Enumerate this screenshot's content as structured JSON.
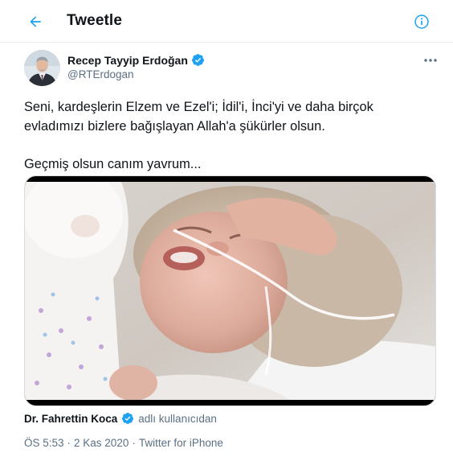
{
  "header": {
    "title": "Tweetle",
    "back_icon": "arrow-left-icon",
    "info_icon": "info-circle-icon",
    "accent_color": "#1da1f2"
  },
  "tweet": {
    "author": {
      "name": "Recep Tayyip Erdoğan",
      "handle": "@RTErdogan",
      "verified": true,
      "verified_color": "#1da1f2"
    },
    "more_icon": "more-dots-icon",
    "text": [
      "Seni, kardeşlerin Elzem ve Ezel'i; İdil'i, İnci'yi ve daha birçok evladımızı bizlere bağışlayan Allah'a şükürler olsun.",
      "Geçmiş olsun canım yavrum..."
    ],
    "attribution": {
      "name": "Dr. Fahrettin Koca",
      "verified": true,
      "suffix": "adlı kullanıcıdan"
    },
    "meta": {
      "time": "ÖS 5:53",
      "separator": "·",
      "date": "2 Kas 2020",
      "source": "Twitter for iPhone"
    }
  }
}
